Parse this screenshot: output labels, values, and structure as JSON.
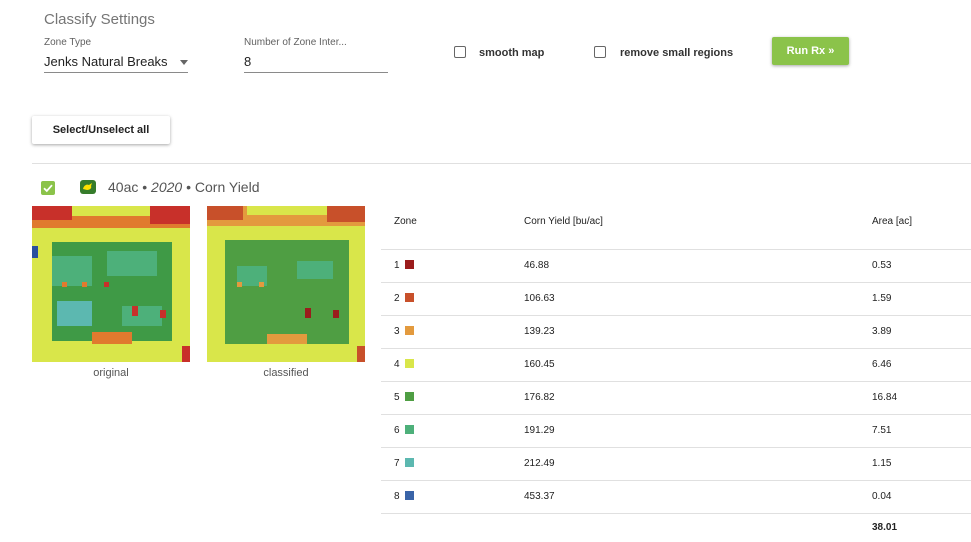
{
  "settings": {
    "title": "Classify Settings",
    "zone_type_label": "Zone Type",
    "zone_type_value": "Jenks Natural Breaks",
    "zone_count_label": "Number of Zone Inter...",
    "zone_count_value": "8",
    "smooth_map_label": "smooth map",
    "smooth_map_checked": false,
    "remove_small_label": "remove small regions",
    "remove_small_checked": false,
    "run_button": "Run Rx »"
  },
  "select_all_button": "Select/Unselect all",
  "field": {
    "checked": true,
    "name": "40ac",
    "sep1": " • ",
    "year": "2020",
    "sep2": " • ",
    "layer": "Corn Yield",
    "caption_original": "original",
    "caption_classified": "classified"
  },
  "table": {
    "headers": {
      "zone": "Zone",
      "yield": "Corn Yield [bu/ac]",
      "area": "Area [ac]"
    },
    "rows": [
      {
        "zone": "1",
        "color": "#9b1c1c",
        "yield": "46.88",
        "area": "0.53"
      },
      {
        "zone": "2",
        "color": "#c8502a",
        "yield": "106.63",
        "area": "1.59"
      },
      {
        "zone": "3",
        "color": "#e39a3e",
        "yield": "139.23",
        "area": "3.89"
      },
      {
        "zone": "4",
        "color": "#d9e64a",
        "yield": "160.45",
        "area": "6.46"
      },
      {
        "zone": "5",
        "color": "#4f9e43",
        "yield": "176.82",
        "area": "16.84"
      },
      {
        "zone": "6",
        "color": "#4db07a",
        "yield": "191.29",
        "area": "7.51"
      },
      {
        "zone": "7",
        "color": "#5cb8b0",
        "yield": "212.49",
        "area": "1.15"
      },
      {
        "zone": "8",
        "color": "#3a64a8",
        "yield": "453.37",
        "area": "0.04"
      }
    ],
    "total_area": "38.01"
  }
}
